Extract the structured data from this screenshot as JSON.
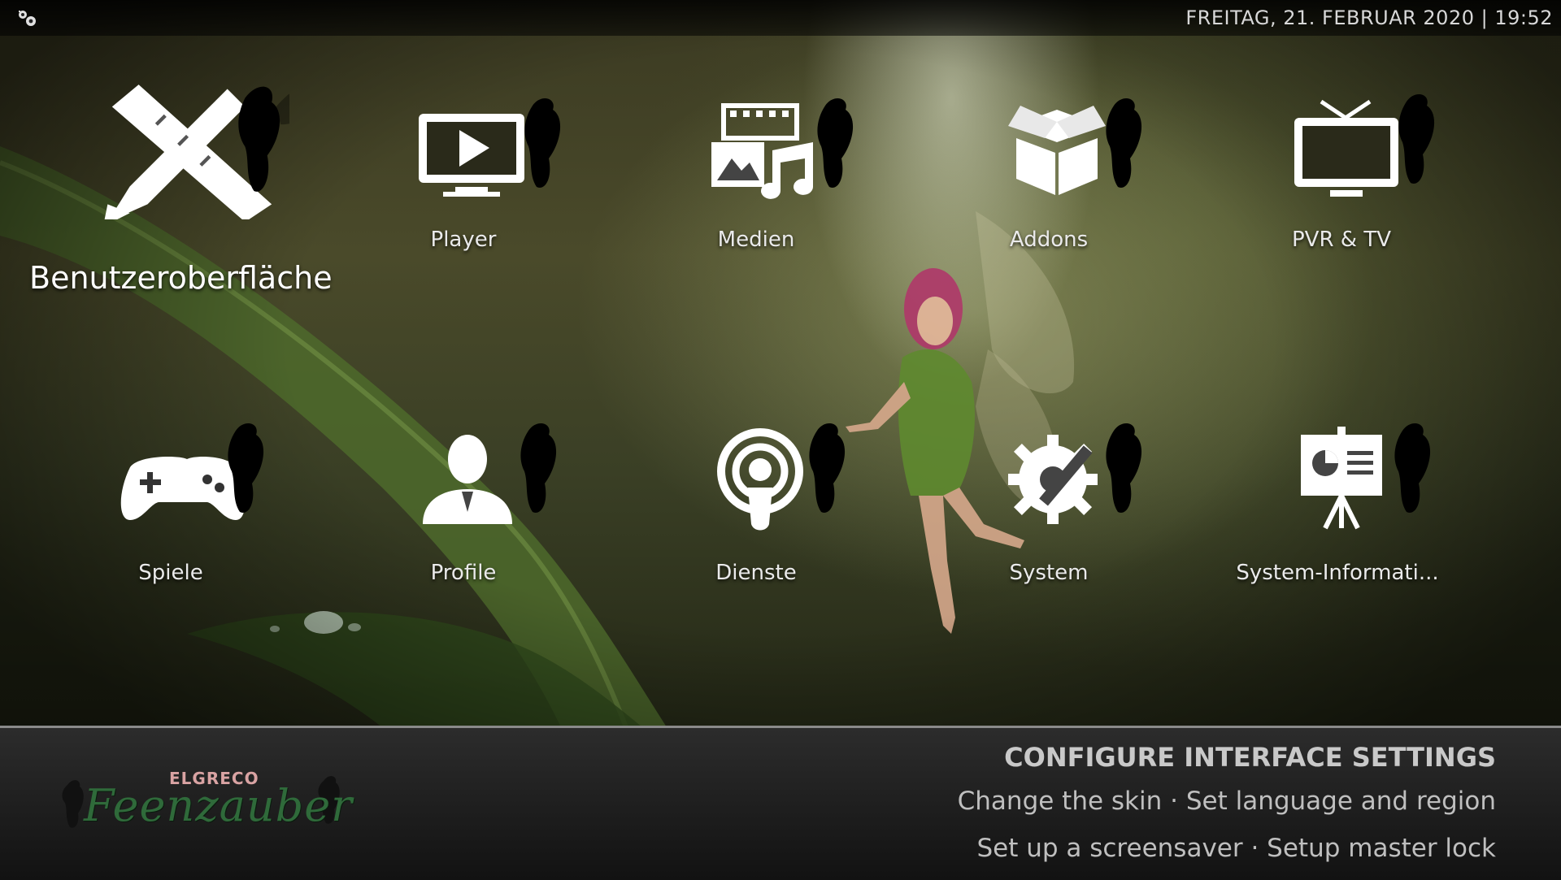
{
  "topbar": {
    "menu_icon": "settings-cluster-icon",
    "datetime": "FREITAG, 21. FEBRUAR 2020 | 19:52"
  },
  "tiles": [
    {
      "label": "Benutzeroberfläche",
      "icon": "pencil-ruler-icon",
      "focused": true
    },
    {
      "label": "Player",
      "icon": "tv-play-icon"
    },
    {
      "label": "Medien",
      "icon": "media-film-music-icon"
    },
    {
      "label": "Addons",
      "icon": "open-box-icon"
    },
    {
      "label": "PVR & TV",
      "icon": "tv-antenna-icon"
    },
    {
      "label": "Spiele",
      "icon": "gamepad-icon"
    },
    {
      "label": "Profile",
      "icon": "user-profile-icon"
    },
    {
      "label": "Dienste",
      "icon": "podcast-signal-icon"
    },
    {
      "label": "System",
      "icon": "gear-wrench-icon"
    },
    {
      "label": "System-Informati...",
      "icon": "presentation-board-icon"
    }
  ],
  "info": {
    "title": "CONFIGURE INTERFACE SETTINGS",
    "line1": "Change the skin · Set language and region",
    "line2": "Set up a screensaver · Setup master lock"
  },
  "logo": {
    "small_text": "ELGRECO",
    "big_text": "Feenzauber"
  },
  "colors": {
    "fairy_silhouette": "#000000",
    "icon": "#ffffff",
    "logo_green": "#2f6a3a"
  }
}
